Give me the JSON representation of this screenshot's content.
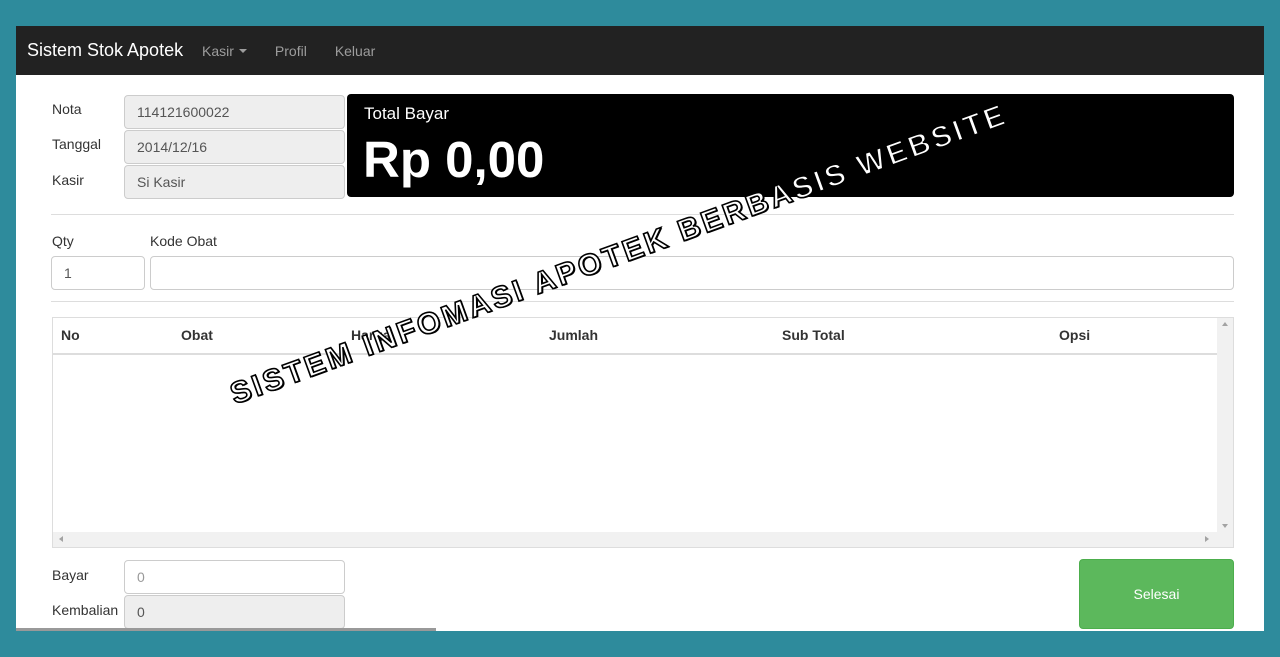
{
  "navbar": {
    "brand": "Sistem Stok Apotek",
    "items": [
      {
        "label": "Kasir",
        "dropdown": true
      },
      {
        "label": "Profil"
      },
      {
        "label": "Keluar"
      }
    ]
  },
  "info": {
    "nota_label": "Nota",
    "nota_value": "114121600022",
    "tanggal_label": "Tanggal",
    "tanggal_value": "2014/12/16",
    "kasir_label": "Kasir",
    "kasir_value": "Si Kasir"
  },
  "total": {
    "label": "Total Bayar",
    "value": "Rp 0,00"
  },
  "entry": {
    "qty_label": "Qty",
    "qty_value": "1",
    "kode_label": "Kode Obat",
    "kode_value": ""
  },
  "table": {
    "columns": [
      "No",
      "Obat",
      "Harga",
      "Jumlah",
      "Sub Total",
      "Opsi"
    ],
    "rows": []
  },
  "payment": {
    "bayar_label": "Bayar",
    "bayar_placeholder": "0",
    "kembalian_label": "Kembalian",
    "kembalian_value": "0",
    "submit_label": "Selesai"
  },
  "watermark": "SISTEM INFOMASI APOTEK BERBASIS WEBSITE",
  "colors": {
    "background": "#2e8b9c",
    "navbar": "#222222",
    "total_box": "#000000",
    "submit": "#5cb85c"
  }
}
